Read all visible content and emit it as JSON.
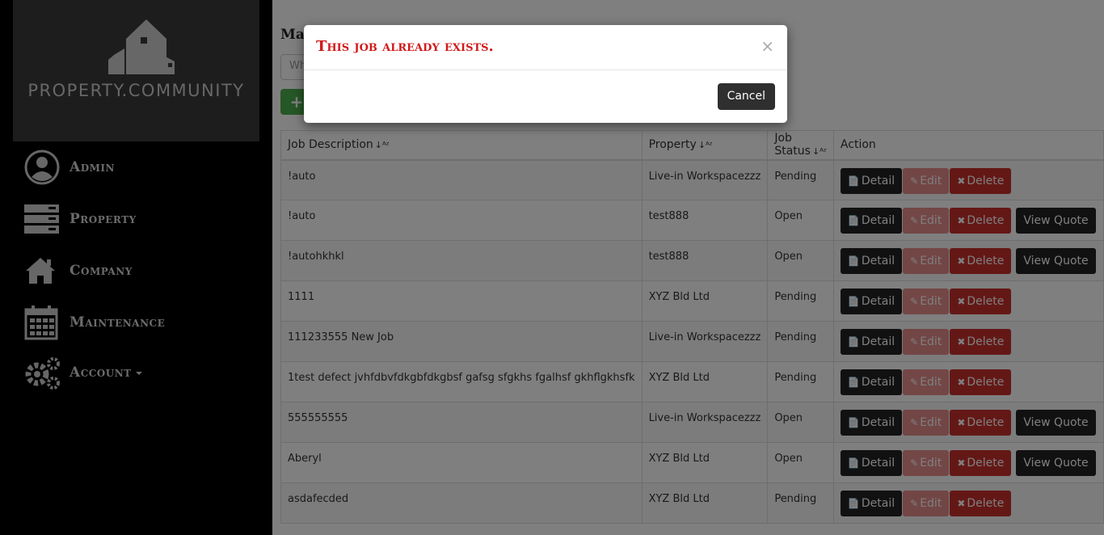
{
  "brand": {
    "name": "PROPERTY.COMMUNITY"
  },
  "sidebar": {
    "items": [
      {
        "label": "Admin",
        "icon": "user-circle-icon"
      },
      {
        "label": "Property",
        "icon": "server-icon"
      },
      {
        "label": "Company",
        "icon": "home-icon"
      },
      {
        "label": "Maintenance",
        "icon": "calendar-icon"
      },
      {
        "label": "Account",
        "icon": "gears-icon"
      }
    ]
  },
  "main": {
    "title_partial": "Ma",
    "search_placeholder_partial": "Wh",
    "add_icon": "+"
  },
  "table": {
    "headers": [
      "Job Description",
      "Property",
      "Job Status",
      "Action"
    ],
    "sort_icon": "sort-alpha-icon",
    "buttons": {
      "detail": "Detail",
      "edit": "Edit",
      "delete": "Delete",
      "quote": "View Quote"
    },
    "rows": [
      {
        "description": "!auto",
        "property": "Live-in Workspacezzz",
        "status": "Pending",
        "quote": false
      },
      {
        "description": "!auto",
        "property": "test888",
        "status": "Open",
        "quote": true
      },
      {
        "description": "!autohkhkl",
        "property": "test888",
        "status": "Open",
        "quote": true
      },
      {
        "description": "1111",
        "property": "XYZ Bld Ltd",
        "status": "Pending",
        "quote": false
      },
      {
        "description": "111233555 New Job",
        "property": "Live-in Workspacezzz",
        "status": "Pending",
        "quote": false
      },
      {
        "description": "1test defect jvhfdbvfdkgbfdkgbsf gafsg sfgkhs fgalhsf gkhflgkhsfk",
        "property": "XYZ Bld Ltd",
        "status": "Pending",
        "quote": false
      },
      {
        "description": "555555555",
        "property": "Live-in Workspacezzz",
        "status": "Open",
        "quote": true
      },
      {
        "description": "Aberyl",
        "property": "XYZ Bld Ltd",
        "status": "Open",
        "quote": true
      },
      {
        "description": "asdafecded",
        "property": "XYZ Bld Ltd",
        "status": "Pending",
        "quote": false
      }
    ]
  },
  "modal": {
    "title": "This job already exists.",
    "close": "×",
    "cancel_label": "Cancel"
  },
  "colors": {
    "alert": "#d11a1a",
    "sidebar": "#000000",
    "logo_bg": "#3a3a3a"
  }
}
